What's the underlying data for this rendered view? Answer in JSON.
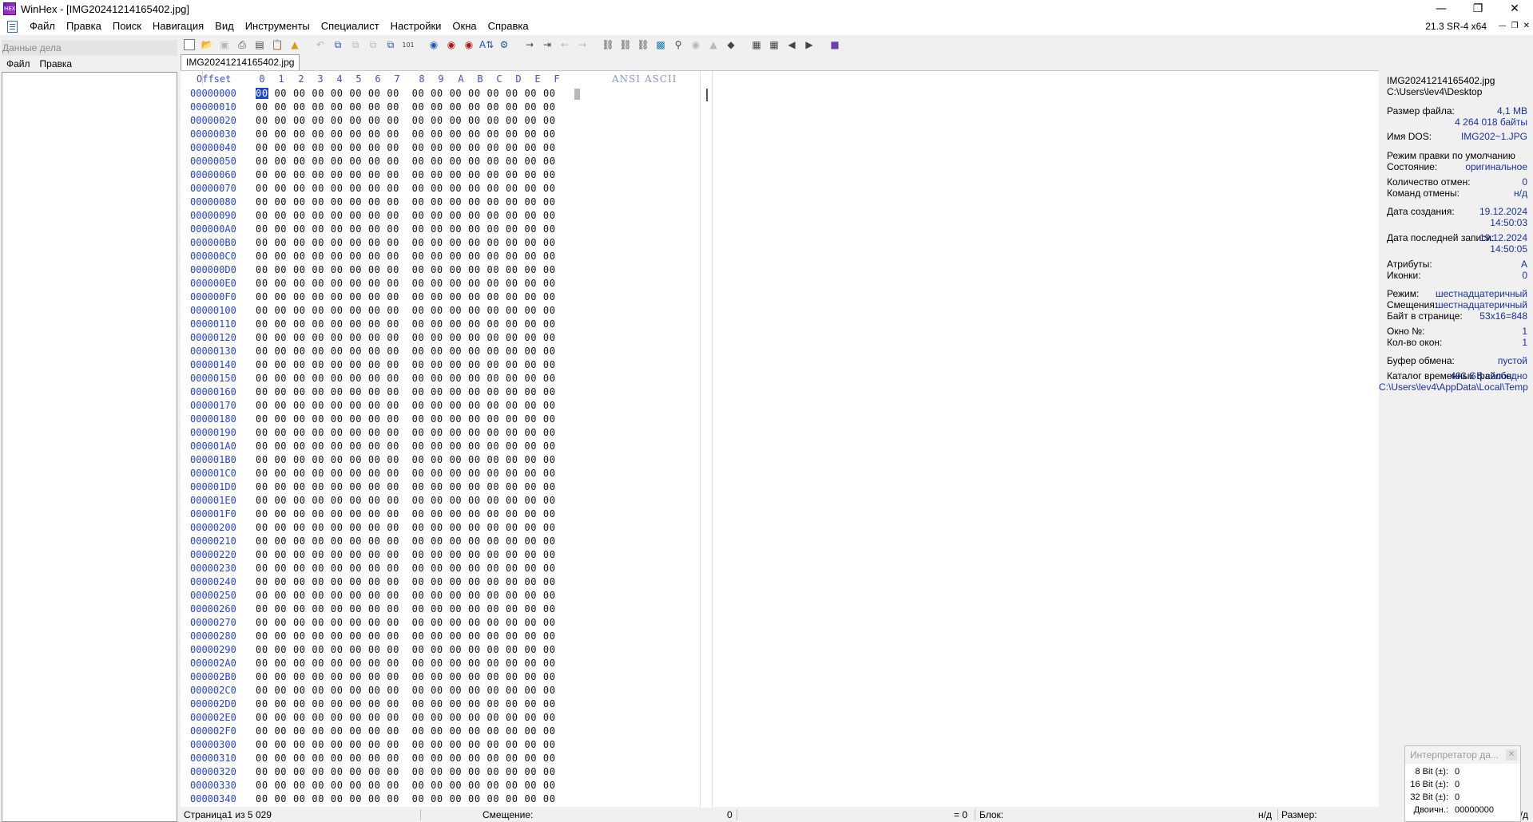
{
  "window": {
    "title": "WinHex - [IMG20241214165402.jpg]",
    "app_icon_text": "HEX",
    "version": "21.3 SR-4 x64"
  },
  "menu": [
    "Файл",
    "Правка",
    "Поиск",
    "Навигация",
    "Вид",
    "Инструменты",
    "Специалист",
    "Настройки",
    "Окна",
    "Справка"
  ],
  "left_pane": {
    "title": "Данные дела",
    "menu": [
      "Файл",
      "Правка"
    ]
  },
  "tab": {
    "label": "IMG20241214165402.jpg"
  },
  "hex": {
    "offset_header": "Offset",
    "columns": [
      "0",
      "1",
      "2",
      "3",
      "4",
      "5",
      "6",
      "7",
      "8",
      "9",
      "A",
      "B",
      "C",
      "D",
      "E",
      "F"
    ],
    "ansi_header": "ANSI ASCII",
    "byte_value": "00",
    "offsets": [
      "00000000",
      "00000010",
      "00000020",
      "00000030",
      "00000040",
      "00000050",
      "00000060",
      "00000070",
      "00000080",
      "00000090",
      "000000A0",
      "000000B0",
      "000000C0",
      "000000D0",
      "000000E0",
      "000000F0",
      "00000100",
      "00000110",
      "00000120",
      "00000130",
      "00000140",
      "00000150",
      "00000160",
      "00000170",
      "00000180",
      "00000190",
      "000001A0",
      "000001B0",
      "000001C0",
      "000001D0",
      "000001E0",
      "000001F0",
      "00000200",
      "00000210",
      "00000220",
      "00000230",
      "00000240",
      "00000250",
      "00000260",
      "00000270",
      "00000280",
      "00000290",
      "000002A0",
      "000002B0",
      "000002C0",
      "000002D0",
      "000002E0",
      "000002F0",
      "00000300",
      "00000310",
      "00000320",
      "00000330",
      "00000340"
    ]
  },
  "info": {
    "filename": "IMG20241214165402.jpg",
    "path": "C:\\Users\\lev4\\Desktop",
    "file_size_label": "Размер файла:",
    "file_size_mb": "4,1 MB",
    "file_size_bytes": "4 264 018 байты",
    "dos_name_label": "Имя DOS:",
    "dos_name": "IMG202~1.JPG",
    "edit_mode": "Режим правки по умолчанию",
    "state_label": "Состояние:",
    "state": "оригинальное",
    "undo_count_label": "Количество отмен:",
    "undo_count": "0",
    "undo_cmd_label": "Команд отмены:",
    "undo_cmd": "н/д",
    "created_label": "Дата создания:",
    "created_date": "19.12.2024",
    "created_time": "14:50:03",
    "modified_label": "Дата последней записи:",
    "modified_date": "19.12.2024",
    "modified_time": "14:50:05",
    "attributes_label": "Атрибуты:",
    "attributes": "A",
    "icons_label": "Иконки:",
    "icons": "0",
    "mode_label": "Режим:",
    "mode": "шестнадцатеричный",
    "offsets_label": "Смещения:",
    "offsets": "шестнадцатеричный",
    "bytes_per_page_label": "Байт в странице:",
    "bytes_per_page": "53x16=848",
    "window_no_label": "Окно №:",
    "window_no": "1",
    "window_count_label": "Кол-во окон:",
    "window_count": "1",
    "clipboard_label": "Буфер обмена:",
    "clipboard": "пустой",
    "temp_label": "Каталог временных файлов:",
    "temp_free": "493 GB свободно",
    "temp_path": "C:\\Users\\lev4\\AppData\\Local\\Temp"
  },
  "status": {
    "page": "Страница1 из 5 029",
    "offset_label": "Смещение:",
    "offset_value": "0",
    "eq": "= 0",
    "block_label": "Блок:",
    "na": "н/д",
    "size_label": "Размер:",
    "na2": "н/д"
  },
  "interpreter": {
    "title": "Интерпретатор да...",
    "rows": [
      {
        "k": "8 Bit (±):",
        "v": "0"
      },
      {
        "k": "16 Bit (±):",
        "v": "0"
      },
      {
        "k": "32 Bit (±):",
        "v": "0"
      },
      {
        "k": "Двоичн.:",
        "v": "00000000"
      }
    ]
  }
}
